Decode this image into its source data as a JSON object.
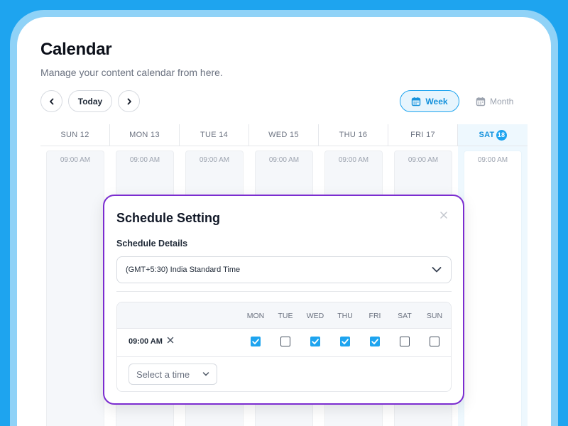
{
  "header": {
    "title": "Calendar",
    "subtitle": "Manage your content calendar from here."
  },
  "toolbar": {
    "today_label": "Today",
    "week_label": "Week",
    "month_label": "Month",
    "active_view": "week"
  },
  "week_days": [
    {
      "label": "SUN 12",
      "time": "09:00 AM"
    },
    {
      "label": "MON 13",
      "time": "09:00 AM"
    },
    {
      "label": "TUE 14",
      "time": "09:00 AM"
    },
    {
      "label": "WED 15",
      "time": "09:00 AM"
    },
    {
      "label": "THU 16",
      "time": "09:00 AM"
    },
    {
      "label": "FRI 17",
      "time": "09:00 AM"
    },
    {
      "label": "SAT",
      "badge": "18",
      "time": "09:00 AM",
      "today": true
    }
  ],
  "modal": {
    "title": "Schedule Setting",
    "section_label": "Schedule Details",
    "timezone_value": "(GMT+5:30) India Standard Time",
    "day_headers": [
      "MON",
      "TUE",
      "WED",
      "THU",
      "FRI",
      "SAT",
      "SUN"
    ],
    "schedule_row": {
      "time": "09:00 AM",
      "checked": [
        true,
        false,
        true,
        true,
        true,
        false,
        false
      ]
    },
    "time_select_placeholder": "Select a time"
  },
  "colors": {
    "background": "#1ea4ef",
    "accent": "#1ea4ef",
    "modal_border": "#7b2cd0"
  }
}
